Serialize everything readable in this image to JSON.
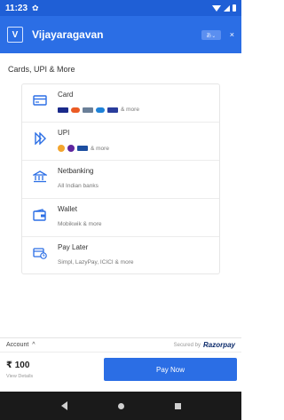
{
  "status_bar": {
    "time": "11:23"
  },
  "header": {
    "logo_letter": "V",
    "merchant_name": "Vijayaragavan",
    "close_symbol": "×"
  },
  "section_title": "Cards, UPI & More",
  "methods": [
    {
      "title": "Card",
      "subtitle": "& more",
      "icon": "card-icon",
      "logos": [
        "visa",
        "mastercard",
        "rupay",
        "maestro",
        "visa-alt"
      ]
    },
    {
      "title": "UPI",
      "subtitle": "& more",
      "icon": "upi-icon",
      "logos": [
        "google-pay",
        "phonepe",
        "paytm"
      ]
    },
    {
      "title": "Netbanking",
      "subtitle": "All Indian banks",
      "icon": "bank-icon"
    },
    {
      "title": "Wallet",
      "subtitle": "Mobikwik & more",
      "icon": "wallet-icon"
    },
    {
      "title": "Pay Later",
      "subtitle": "Simpl, LazyPay, ICICI & more",
      "icon": "paylater-icon"
    }
  ],
  "account_bar": {
    "label": "Account",
    "caret": "^",
    "secured_text": "Secured by",
    "brand": "Razorpay"
  },
  "footer": {
    "amount": "₹ 100",
    "view_details": "View Details",
    "pay_label": "Pay Now"
  },
  "colors": {
    "primary": "#2b6ee5",
    "status_bar": "#1f5fd6",
    "nav_bar": "#1a1a1a",
    "brand_dark": "#0b2a6b"
  }
}
